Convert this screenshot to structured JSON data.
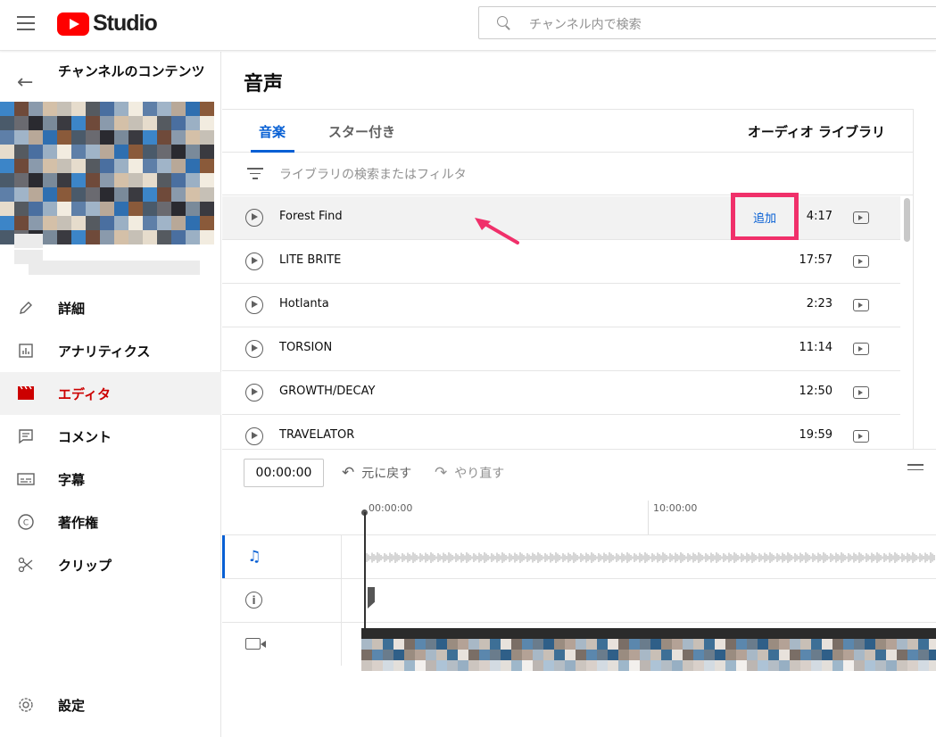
{
  "header": {
    "logo_text": "Studio",
    "search_placeholder": "チャンネル内で検索"
  },
  "sidebar": {
    "channel_title": "チャンネルのコンテンツ",
    "items": [
      {
        "label": "詳細",
        "icon": "pencil-icon"
      },
      {
        "label": "アナリティクス",
        "icon": "analytics-icon"
      },
      {
        "label": "エディタ",
        "icon": "editor-clapper-icon",
        "active": true
      },
      {
        "label": "コメント",
        "icon": "comment-icon"
      },
      {
        "label": "字幕",
        "icon": "subtitles-icon"
      },
      {
        "label": "著作権",
        "icon": "copyright-icon"
      },
      {
        "label": "クリップ",
        "icon": "scissors-icon"
      }
    ],
    "settings_label": "設定"
  },
  "main": {
    "page_title": "音声",
    "tabs": [
      {
        "label": "音楽",
        "active": true
      },
      {
        "label": "スター付き",
        "active": false
      }
    ],
    "library_title": "オーディオ ライブラリ",
    "filter_placeholder": "ライブラリの検索またはフィルタ",
    "add_label": "追加",
    "tracks": [
      {
        "name": "Forest Find",
        "duration": "4:17"
      },
      {
        "name": "LITE BRITE",
        "duration": "17:57"
      },
      {
        "name": "Hotlanta",
        "duration": "2:23"
      },
      {
        "name": "TORSION",
        "duration": "11:14"
      },
      {
        "name": "GROWTH/DECAY",
        "duration": "12:50"
      },
      {
        "name": "TRAVELATOR",
        "duration": "19:59"
      }
    ]
  },
  "timeline": {
    "timecode": "00:00:00",
    "undo_label": "元に戻す",
    "redo_label": "やり直す",
    "ruler": [
      "00:00:00",
      "10:00:00"
    ]
  },
  "colors": {
    "accent_blue": "#065fd4",
    "active_red": "#cc0000",
    "highlight_pink": "#f0306a",
    "brand_red": "#ff0000"
  }
}
